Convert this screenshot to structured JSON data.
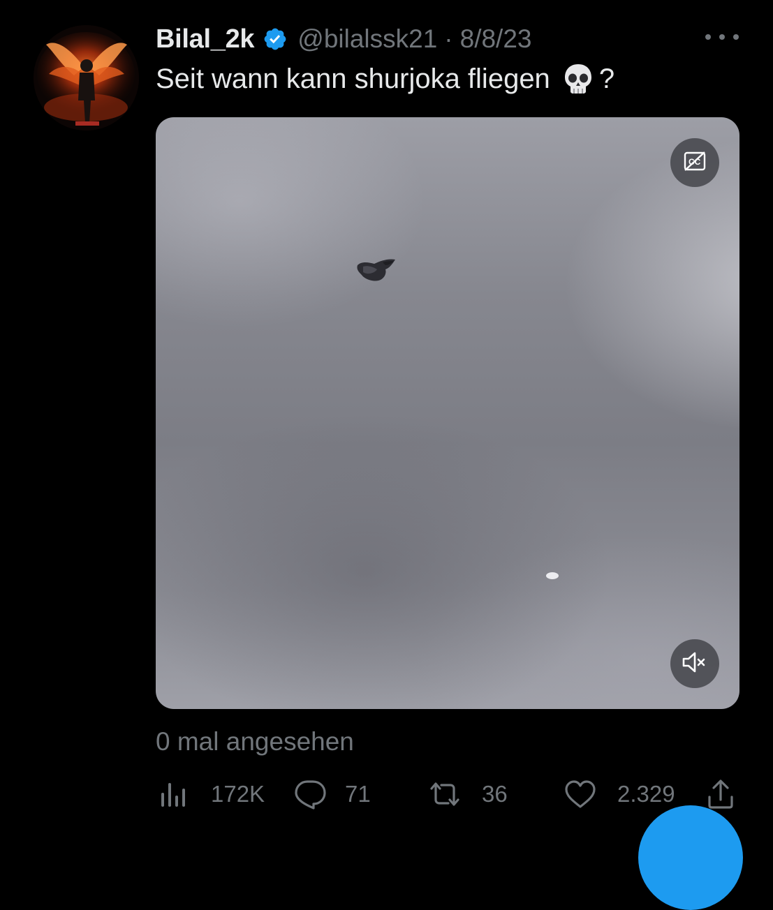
{
  "tweet": {
    "display_name": "Bilal_2k",
    "handle": "@bilalssk21",
    "separator": "·",
    "date": "8/8/23",
    "text_before_emoji": "Seit wann kann shurjoka fliegen",
    "emoji": "skull-emoji",
    "text_after_emoji": "?",
    "verified": true
  },
  "media": {
    "type": "video",
    "captions_icon": "captions-off-icon",
    "mute_icon": "volume-muted-icon"
  },
  "views_text": "0 mal angesehen",
  "actions": {
    "views": {
      "icon": "analytics-icon",
      "count": "172K"
    },
    "replies": {
      "icon": "reply-icon",
      "count": "71"
    },
    "retweets": {
      "icon": "retweet-icon",
      "count": "36"
    },
    "likes": {
      "icon": "heart-icon",
      "count": "2.329"
    },
    "share": {
      "icon": "share-icon"
    }
  },
  "colors": {
    "background": "#000000",
    "primary_text": "#e7e9ea",
    "secondary_text": "#71767b",
    "verified_badge": "#1d9bf0",
    "accent": "#1d9bf0"
  }
}
